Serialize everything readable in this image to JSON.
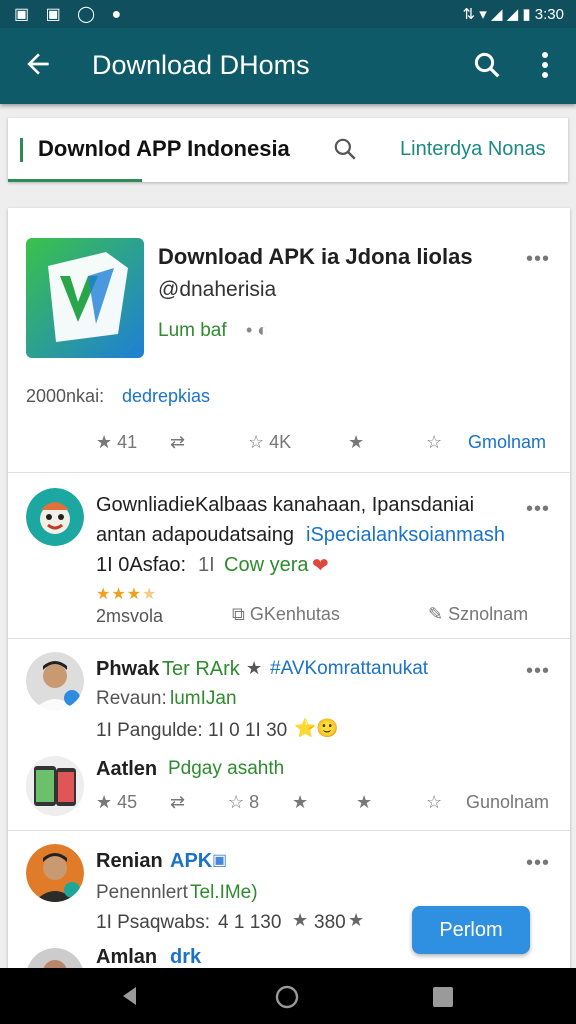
{
  "status_bar": {
    "left_icons": [
      "image-icon",
      "photo-icon",
      "o-icon",
      "circle-icon"
    ],
    "time": "3:30"
  },
  "app_bar": {
    "title": "Download DHoms"
  },
  "tabs": {
    "active": "Downlod APP Indonesia",
    "second": "Linterdya Nonas"
  },
  "posts": [
    {
      "title": "Download APK ia Jdona liolas",
      "handle": "@dnaherisia",
      "meta": "Lum baf",
      "caption_a": "2000nkai:",
      "caption_b": "dedrepkias",
      "actions": [
        "41",
        "",
        "4K",
        "",
        "",
        "Gmolnam"
      ]
    },
    {
      "line1": "GownliadieKalbaas kanahaan, Ipansdaniai",
      "line2a": "antan adapoudatsaing",
      "line2b": "iSpecialanksoianmash",
      "line3a": "1I 0Asfao:",
      "line3b": "1I",
      "line3c": "Cow yera",
      "rating": 3.5,
      "sub": "2msvola",
      "share": "GKenhutas",
      "more": "Sznolnam"
    },
    {
      "name": "Phwak",
      "tag": "Ter RArk",
      "hashtag": "#AVKomrattanukat",
      "sub_a": "Revaun:",
      "sub_b": "lumIJan",
      "stats_a": "1I Pangulde:",
      "stats_b": "1I 0 1I 30",
      "name2": "Aatlen",
      "tag2": "Pdgay asahth",
      "actions": [
        "45",
        "",
        "8",
        "",
        "",
        "Gunolnam"
      ]
    },
    {
      "name": "Renian",
      "tag": "APK",
      "sub_a": "Penennlert",
      "sub_b": "Tel.IMe)",
      "stats_a": "1I Psaqwabs:",
      "stats_b": "4 1 130",
      "stats_c": "380",
      "cta": "Perlom",
      "name2": "Amlan",
      "tag2": "drk"
    }
  ]
}
